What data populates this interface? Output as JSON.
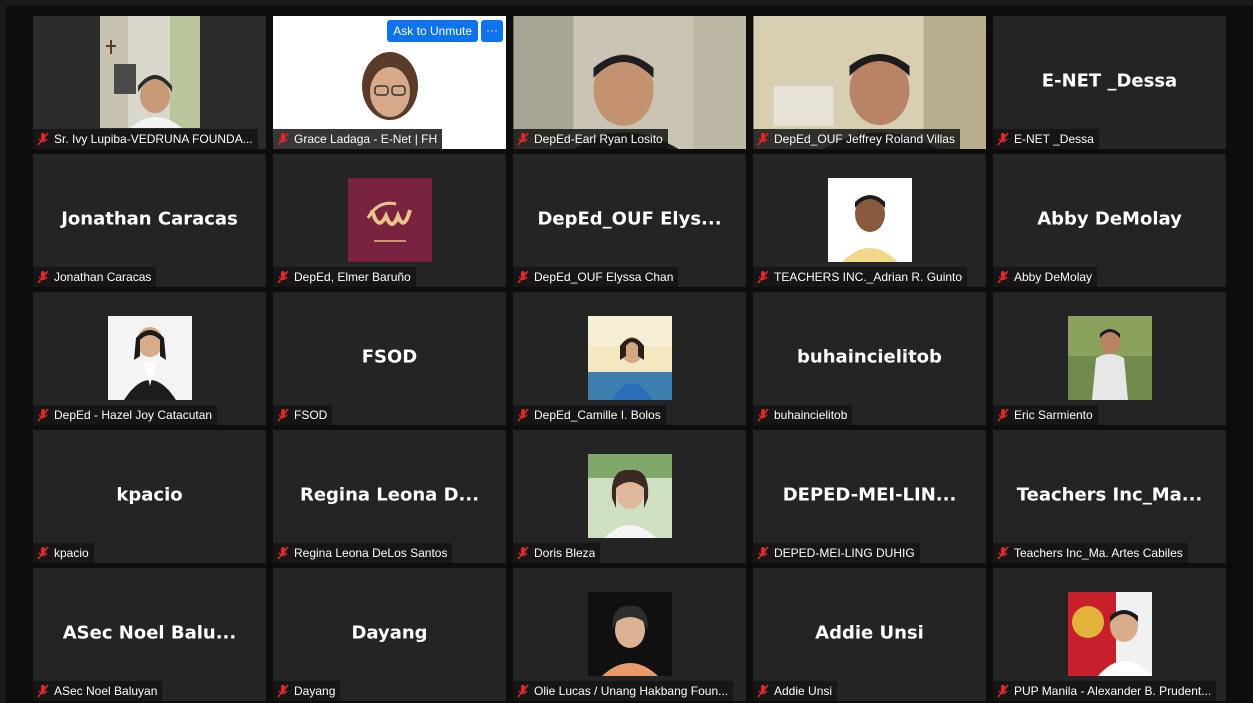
{
  "colors": {
    "tile_bg": "#242424",
    "mute_red": "#e02828",
    "accent": "#0e72ed"
  },
  "controls": {
    "ask_to_unmute": "Ask to Unmute",
    "more_options": "···"
  },
  "participants": [
    {
      "label": "Sr. Ivy Lupiba-VEDRUNA FOUNDA...",
      "muted": true,
      "video": true
    },
    {
      "label": "Grace Ladaga - E-Net | FH",
      "muted": true,
      "video": true
    },
    {
      "label": "DepEd-Earl Ryan Losito",
      "muted": true,
      "video": true
    },
    {
      "label": "DepEd_OUF Jeffrey Roland Villas",
      "muted": true,
      "video": true
    },
    {
      "label": "E-NET _Dessa",
      "display_name": "E-NET _Dessa",
      "muted": true
    },
    {
      "label": "Jonathan Caracas",
      "display_name": "Jonathan Caracas",
      "muted": true
    },
    {
      "label": "DepEd, Elmer Baruño",
      "muted": true,
      "avatar": "logo"
    },
    {
      "label": "DepEd_OUF Elyssa Chan",
      "display_name": "DepEd_OUF  Elys...",
      "muted": true
    },
    {
      "label": "TEACHERS INC._Adrian R. Guinto",
      "muted": true,
      "avatar": "photo"
    },
    {
      "label": "Abby DeMolay",
      "display_name": "Abby DeMolay",
      "muted": true
    },
    {
      "label": "DepEd - Hazel Joy Catacutan",
      "muted": true,
      "avatar": "photo"
    },
    {
      "label": "FSOD",
      "display_name": "FSOD",
      "muted": true
    },
    {
      "label": "DepEd_Camille I. Bolos",
      "muted": true,
      "avatar": "photo"
    },
    {
      "label": "buhaincielitob",
      "display_name": "buhaincielitob",
      "muted": true
    },
    {
      "label": "Eric Sarmiento",
      "muted": true,
      "avatar": "photo"
    },
    {
      "label": "kpacio",
      "display_name": "kpacio",
      "muted": true
    },
    {
      "label": "Regina Leona DeLos Santos",
      "display_name": "Regina  Leona  D...",
      "muted": true
    },
    {
      "label": "Doris Bleza",
      "muted": true,
      "avatar": "photo"
    },
    {
      "label": "DEPED-MEI-LING DUHIG",
      "display_name": "DEPED-MEI-LIN...",
      "muted": true
    },
    {
      "label": "Teachers Inc_Ma. Artes Cabiles",
      "display_name": "Teachers  Inc_Ma...",
      "muted": true
    },
    {
      "label": "ASec Noel Baluyan",
      "display_name": "ASec  Noel  Balu...",
      "muted": true
    },
    {
      "label": "Dayang",
      "display_name": "Dayang",
      "muted": true
    },
    {
      "label": "Olie Lucas / Unang Hakbang Foun...",
      "muted": true,
      "avatar": "photo"
    },
    {
      "label": "Addie Unsi",
      "display_name": "Addie Unsi",
      "muted": true
    },
    {
      "label": "PUP Manila - Alexander B. Prudent...",
      "muted": true,
      "avatar": "photo"
    }
  ]
}
